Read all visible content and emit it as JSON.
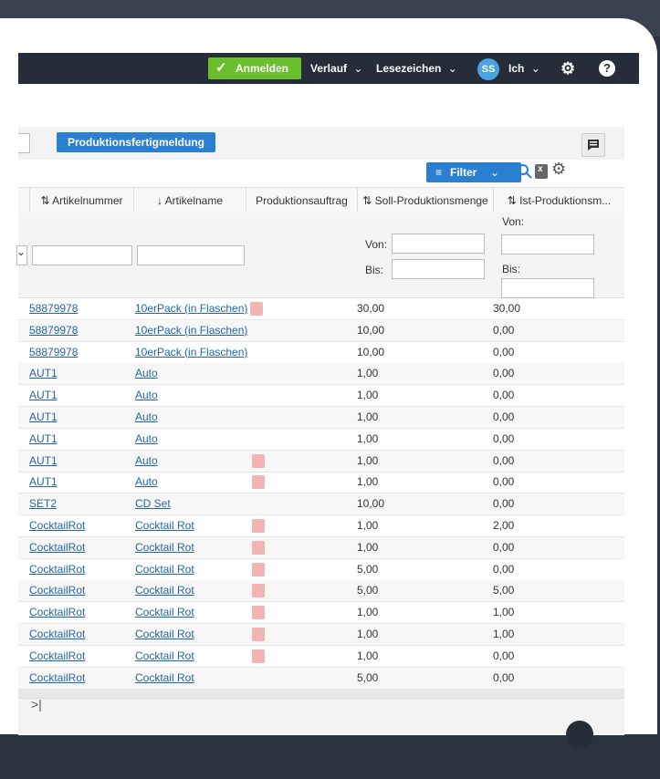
{
  "navbar": {
    "login_label": "Anmelden",
    "history_label": "Verlauf",
    "bookmarks_label": "Lesezeichen",
    "avatar_initials": "SS",
    "user_label": "Ich",
    "chevron": "⌄"
  },
  "toolbar": {
    "production_button": "Produktionsfertigmeldung"
  },
  "filterbar": {
    "filter_label": "Filter",
    "filter_icon": "≡"
  },
  "table": {
    "headers": {
      "artikelnummer": "⇅ Artikelnummer",
      "artikelname": "↓ Artikelname",
      "produktionsauftrag": "Produktionsauftrag",
      "soll": "⇅ Soll-Produktionsmenge",
      "ist": "⇅ Ist-Produktionsm..."
    },
    "filter_labels": {
      "von": "Von:",
      "bis": "Bis:"
    },
    "rows": [
      {
        "art": "58879978",
        "name": "10erPack (in Flaschen)",
        "icon": true,
        "soll": "30,00",
        "ist": "30,00"
      },
      {
        "art": "58879978",
        "name": "10erPack (in Flaschen)",
        "icon": false,
        "soll": "10,00",
        "ist": "0,00"
      },
      {
        "art": "58879978",
        "name": "10erPack (in Flaschen)",
        "icon": false,
        "soll": "10,00",
        "ist": "0,00"
      },
      {
        "art": "AUT1",
        "name": "Auto",
        "icon": false,
        "soll": "1,00",
        "ist": "0,00"
      },
      {
        "art": "AUT1",
        "name": "Auto",
        "icon": false,
        "soll": "1,00",
        "ist": "0,00"
      },
      {
        "art": "AUT1",
        "name": "Auto",
        "icon": false,
        "soll": "1,00",
        "ist": "0,00"
      },
      {
        "art": "AUT1",
        "name": "Auto",
        "icon": false,
        "soll": "1,00",
        "ist": "0,00"
      },
      {
        "art": "AUT1",
        "name": "Auto",
        "icon": true,
        "soll": "1,00",
        "ist": "0,00"
      },
      {
        "art": "AUT1",
        "name": "Auto",
        "icon": true,
        "soll": "1,00",
        "ist": "0,00"
      },
      {
        "art": "SET2",
        "name": "CD Set",
        "icon": false,
        "soll": "10,00",
        "ist": "0,00"
      },
      {
        "art": "CocktailRot",
        "name": "Cocktail Rot",
        "icon": true,
        "soll": "1,00",
        "ist": "2,00"
      },
      {
        "art": "CocktailRot",
        "name": "Cocktail Rot",
        "icon": true,
        "soll": "1,00",
        "ist": "0,00"
      },
      {
        "art": "CocktailRot",
        "name": "Cocktail Rot",
        "icon": true,
        "soll": "5,00",
        "ist": "0,00"
      },
      {
        "art": "CocktailRot",
        "name": "Cocktail Rot",
        "icon": true,
        "soll": "5,00",
        "ist": "5,00"
      },
      {
        "art": "CocktailRot",
        "name": "Cocktail Rot",
        "icon": true,
        "soll": "1,00",
        "ist": "1,00"
      },
      {
        "art": "CocktailRot",
        "name": "Cocktail Rot",
        "icon": true,
        "soll": "1,00",
        "ist": "1,00"
      },
      {
        "art": "CocktailRot",
        "name": "Cocktail Rot",
        "icon": true,
        "soll": "1,00",
        "ist": "0,00"
      },
      {
        "art": "CocktailRot",
        "name": "Cocktail Rot",
        "icon": false,
        "soll": "5,00",
        "ist": "0,00"
      }
    ]
  },
  "footer": {
    "last_page": ">|"
  }
}
